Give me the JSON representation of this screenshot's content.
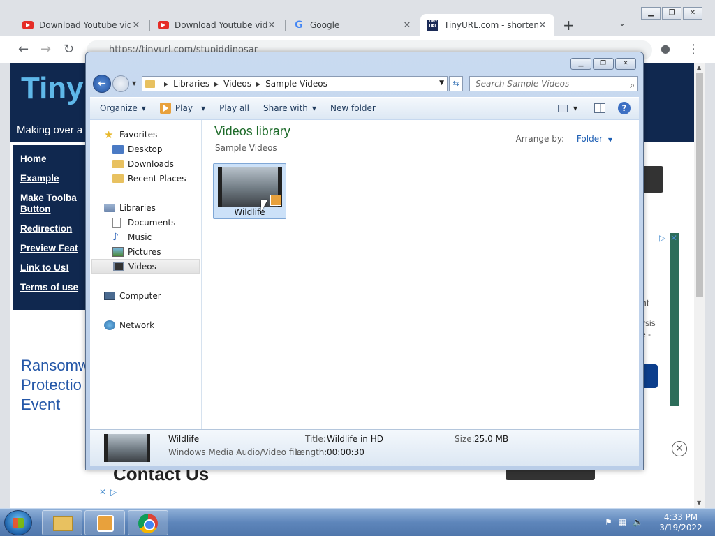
{
  "browser": {
    "tabs": [
      {
        "title": "Download Youtube vide",
        "icon": "youtube-icon"
      },
      {
        "title": "Download Youtube vide",
        "icon": "youtube-icon"
      },
      {
        "title": "Google",
        "icon": "google-icon"
      },
      {
        "title": "TinyURL.com - shorten",
        "icon": "tinyurl-icon"
      }
    ],
    "url": "https://tinyurl.com/stupiddinosar",
    "new_tab": "+"
  },
  "page": {
    "logo": "TinyU",
    "tagline": "Making over a",
    "nav": [
      "Home",
      "Example",
      "Make Toolba Button",
      "Redirection",
      "Preview Feat",
      "Link to Us!",
      "Terms of use"
    ],
    "ad_text": [
      "Ransomw",
      "Protectio",
      "Event"
    ],
    "contact": "Contact Us",
    "ad_right_text": [
      "nt",
      "ysis",
      "e -"
    ]
  },
  "explorer": {
    "breadcrumb": [
      "Libraries",
      "Videos",
      "Sample Videos"
    ],
    "search_placeholder": "Search Sample Videos",
    "commands": {
      "organize": "Organize",
      "play": "Play",
      "play_all": "Play all",
      "share_with": "Share with",
      "new_folder": "New folder"
    },
    "nav": {
      "favorites": "Favorites",
      "desktop": "Desktop",
      "downloads": "Downloads",
      "recent_places": "Recent Places",
      "libraries": "Libraries",
      "documents": "Documents",
      "music": "Music",
      "pictures": "Pictures",
      "videos": "Videos",
      "computer": "Computer",
      "network": "Network"
    },
    "library_title": "Videos library",
    "library_subtitle": "Sample Videos",
    "arrange_label": "Arrange by:",
    "arrange_value": "Folder",
    "file": {
      "name": "Wildlife"
    },
    "details": {
      "name": "Wildlife",
      "type": "Windows Media Audio/Video file",
      "title_label": "Title:",
      "title_value": "Wildlife in HD",
      "length_label": "Length:",
      "length_value": "00:00:30",
      "size_label": "Size:",
      "size_value": "25.0 MB"
    }
  },
  "taskbar": {
    "time": "4:33 PM",
    "date": "3/19/2022"
  }
}
